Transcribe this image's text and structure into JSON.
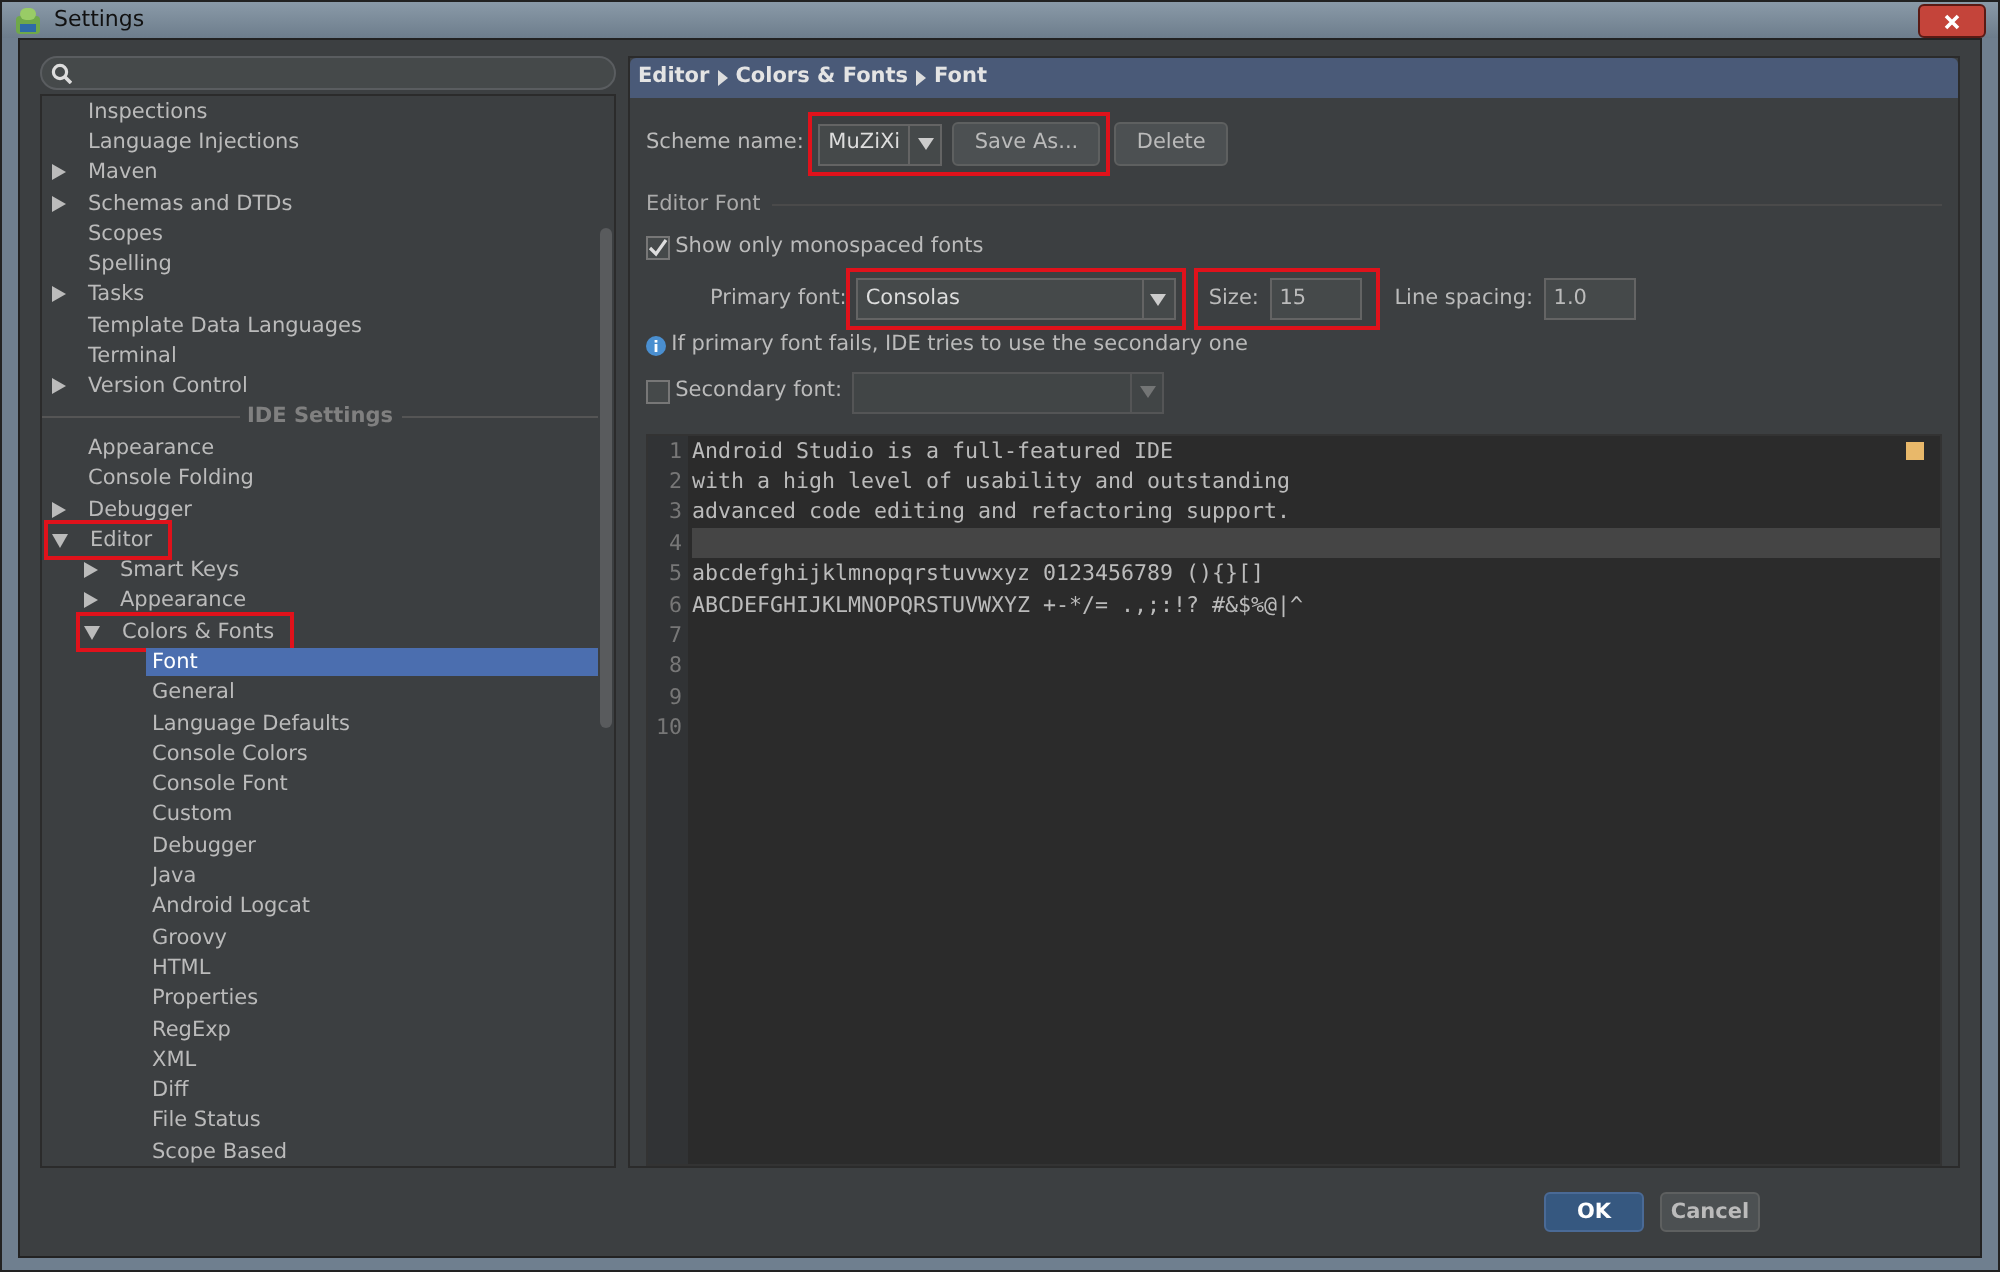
{
  "window": {
    "title": "Settings"
  },
  "tree": [
    {
      "kind": "item",
      "label": "Inspections"
    },
    {
      "kind": "item",
      "label": "Language Injections"
    },
    {
      "kind": "item",
      "label": "Maven",
      "expanded": false
    },
    {
      "kind": "item",
      "label": "Schemas and DTDs",
      "expanded": false
    },
    {
      "kind": "item",
      "label": "Scopes"
    },
    {
      "kind": "item",
      "label": "Spelling"
    },
    {
      "kind": "item",
      "label": "Tasks",
      "expanded": false
    },
    {
      "kind": "item",
      "label": "Template Data Languages"
    },
    {
      "kind": "item",
      "label": "Terminal"
    },
    {
      "kind": "item",
      "label": "Version Control",
      "expanded": false
    },
    {
      "kind": "header",
      "label": "IDE Settings"
    },
    {
      "kind": "item",
      "label": "Appearance"
    },
    {
      "kind": "item",
      "label": "Console Folding"
    },
    {
      "kind": "item",
      "label": "Debugger",
      "expanded": false
    },
    {
      "kind": "item",
      "label": "Editor",
      "expanded": true,
      "highlighted": true,
      "children": [
        {
          "kind": "item",
          "label": "Smart Keys",
          "expanded": false
        },
        {
          "kind": "item",
          "label": "Appearance",
          "expanded": false
        },
        {
          "kind": "item",
          "label": "Colors & Fonts",
          "expanded": true,
          "highlighted": true,
          "children": [
            {
              "kind": "item",
              "label": "Font",
              "selected": true
            },
            {
              "kind": "item",
              "label": "General",
              "selected": false
            },
            {
              "kind": "item",
              "label": "Language Defaults",
              "selected": false
            },
            {
              "kind": "item",
              "label": "Console Colors",
              "selected": false
            },
            {
              "kind": "item",
              "label": "Console Font",
              "selected": false
            },
            {
              "kind": "item",
              "label": "Custom",
              "selected": false
            },
            {
              "kind": "item",
              "label": "Debugger",
              "selected": false
            },
            {
              "kind": "item",
              "label": "Java",
              "selected": false
            },
            {
              "kind": "item",
              "label": "Android Logcat",
              "selected": false
            },
            {
              "kind": "item",
              "label": "Groovy",
              "selected": false
            },
            {
              "kind": "item",
              "label": "HTML",
              "selected": false
            },
            {
              "kind": "item",
              "label": "Properties",
              "selected": false
            },
            {
              "kind": "item",
              "label": "RegExp",
              "selected": false
            },
            {
              "kind": "item",
              "label": "XML",
              "selected": false
            },
            {
              "kind": "item",
              "label": "Diff",
              "selected": false
            },
            {
              "kind": "item",
              "label": "File Status",
              "selected": false
            },
            {
              "kind": "item",
              "label": "Scope Based",
              "selected": false
            }
          ]
        }
      ]
    }
  ],
  "breadcrumb": [
    "Editor",
    "Colors & Fonts",
    "Font"
  ],
  "scheme": {
    "label": "Scheme name:",
    "value": "MuZiXi",
    "save_button": "Save As...",
    "highlighted": true
  },
  "delete_button": "Delete",
  "editor_font": {
    "title": "Editor Font",
    "monospaced": {
      "label": "Show only monospaced fonts",
      "checked": true
    },
    "primary_font": {
      "label": "Primary font:",
      "value": "Consolas",
      "highlighted": true
    },
    "size": {
      "label": "Size:",
      "value": "15",
      "highlighted": true
    },
    "line_spacing": {
      "label": "Line spacing:",
      "value": "1.0"
    },
    "note": "If primary font fails, IDE tries to use the secondary one",
    "secondary_font": {
      "label": "Secondary font:",
      "checked": false
    }
  },
  "preview": [
    {
      "number": "1",
      "text": "Android Studio is a full-featured IDE",
      "current": false
    },
    {
      "number": "2",
      "text": "with a high level of usability and outstanding",
      "current": false
    },
    {
      "number": "3",
      "text": "advanced code editing and refactoring support.",
      "current": false
    },
    {
      "number": "4",
      "current": true
    },
    {
      "number": "5",
      "text": "abcdefghijklmnopqrstuvwxyz 0123456789 (){}[]",
      "current": false
    },
    {
      "number": "6",
      "text": "ABCDEFGHIJKLMNOPQRSTUVWXYZ +-*/= .,;:!? #&$%@|^",
      "current": false
    },
    {
      "number": "7",
      "current": false
    },
    {
      "number": "8",
      "current": false
    },
    {
      "number": "9",
      "current": false
    },
    {
      "number": "10",
      "current": false
    }
  ],
  "footer_buttons": [
    {
      "label": "OK",
      "default": true
    },
    {
      "label": "Cancel",
      "default": false
    }
  ]
}
